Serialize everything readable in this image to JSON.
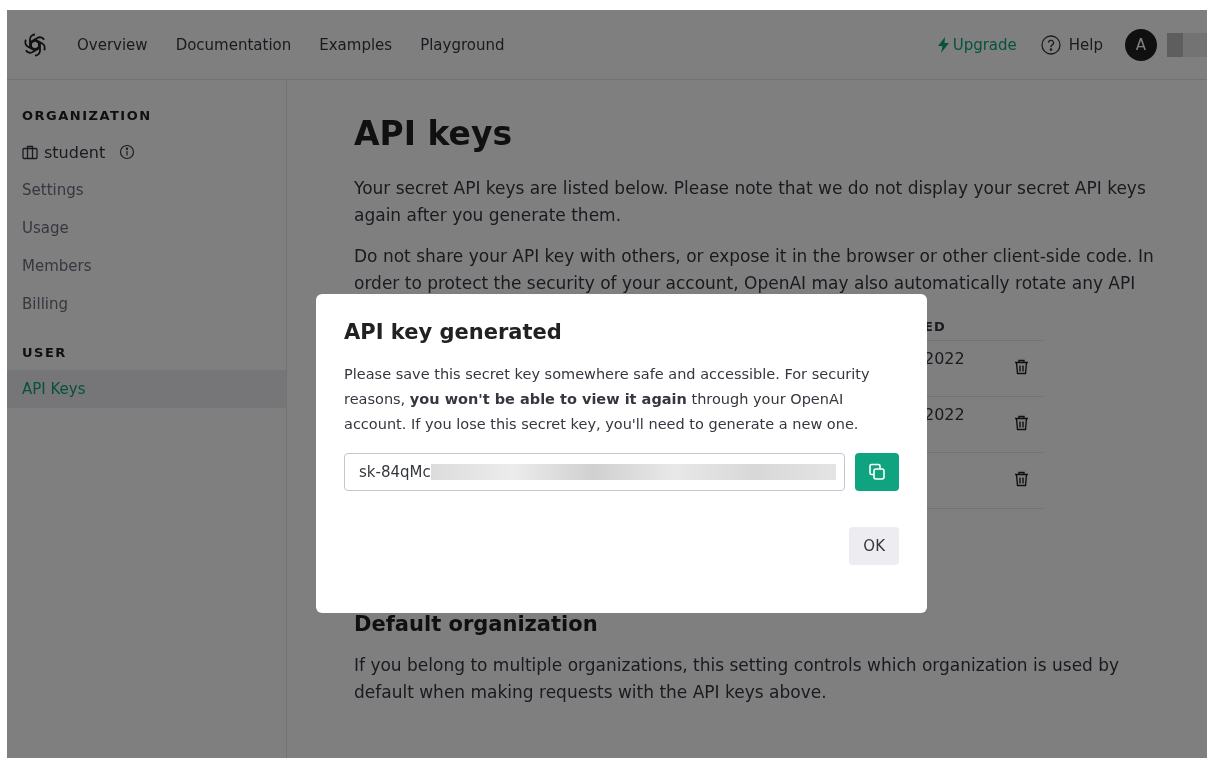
{
  "nav": {
    "links": [
      {
        "label": "Overview"
      },
      {
        "label": "Documentation"
      },
      {
        "label": "Examples"
      },
      {
        "label": "Playground"
      }
    ],
    "upgrade": "Upgrade",
    "help": "Help",
    "avatar": "A"
  },
  "sidebar": {
    "sections": [
      {
        "heading": "ORGANIZATION",
        "items": [
          {
            "label": "student",
            "kind": "org",
            "selected": false
          },
          {
            "label": "Settings",
            "kind": "link",
            "selected": false
          },
          {
            "label": "Usage",
            "kind": "link",
            "selected": false
          },
          {
            "label": "Members",
            "kind": "link",
            "selected": false
          },
          {
            "label": "Billing",
            "kind": "link",
            "selected": false
          }
        ]
      },
      {
        "heading": "USER",
        "items": [
          {
            "label": "API Keys",
            "kind": "link",
            "selected": true
          }
        ]
      }
    ]
  },
  "main": {
    "title": "API keys",
    "paragraphs": [
      "Your secret API keys are listed below. Please note that we do not display your secret API keys again after you generate them.",
      "Do not share your API key with others, or expose it in the browser or other client-side code. In order to protect the security of your account, OpenAI may also automatically rotate any API"
    ],
    "table": {
      "column_header": "ED",
      "rows": [
        {
          "cell": "2022"
        },
        {
          "cell": "2022"
        },
        {
          "cell": ""
        }
      ]
    },
    "section_title": "Default organization",
    "section_text": "If you belong to multiple organizations, this setting controls which organization is used by default when making requests with the API keys above."
  },
  "modal": {
    "title": "API key generated",
    "text": "Please save this secret key somewhere safe and accessible. For security reasons, **you won't be able to view it again** through your OpenAI account. If you lose this secret key, you'll need to generate a new one.",
    "key_value": "sk-84qMc",
    "ok": "OK"
  }
}
